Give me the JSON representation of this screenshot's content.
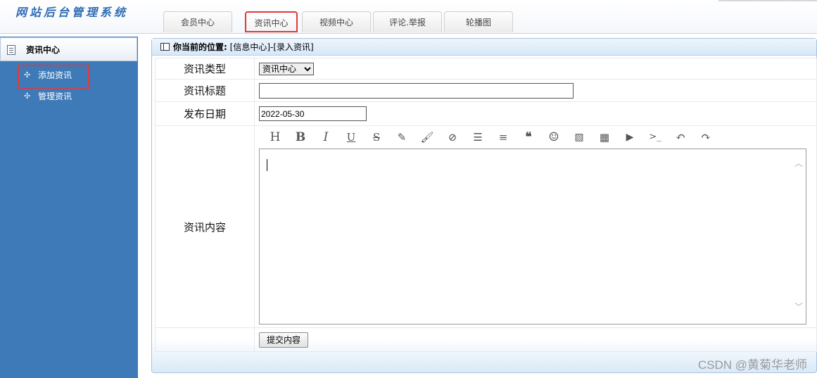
{
  "app": {
    "title": "网站后台管理系统"
  },
  "tabs": [
    {
      "label": "会员中心"
    },
    {
      "label": "资讯中心"
    },
    {
      "label": "视频中心"
    },
    {
      "label": "评论.举报"
    },
    {
      "label": "轮播图"
    }
  ],
  "sidebar": {
    "title": "资讯中心",
    "items": [
      {
        "label": "添加资讯"
      },
      {
        "label": "管理资讯"
      }
    ]
  },
  "breadcrumb": {
    "prefix": "你当前的位置:",
    "path": "[信息中心]-[录入资讯]"
  },
  "form": {
    "type_label": "资讯类型",
    "type_value": "资讯中心",
    "title_label": "资讯标题",
    "title_value": "",
    "date_label": "发布日期",
    "date_value": "2022-05-30",
    "content_label": "资讯内容",
    "submit_label": "提交内容"
  },
  "toolbar_icons": [
    "heading-icon",
    "bold-icon",
    "italic-icon",
    "underline-icon",
    "strikethrough-icon",
    "highlighter-icon",
    "brush-icon",
    "link-icon",
    "list-icon",
    "align-left-icon",
    "quote-icon",
    "emoji-icon",
    "image-icon",
    "table-icon",
    "video-icon",
    "code-icon",
    "undo-icon",
    "redo-icon"
  ],
  "watermark": "CSDN @黄菊华老师",
  "colors": {
    "sidebar_bg": "#3e7ab8",
    "highlight": "#e03a3a",
    "logo": "#2f6db5"
  }
}
